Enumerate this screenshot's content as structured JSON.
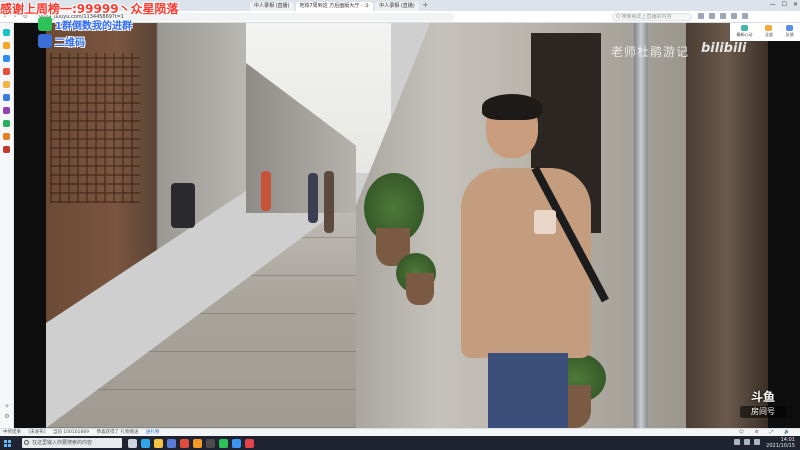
{
  "browser": {
    "tabs": [
      {
        "label": "中人录相 (直播)"
      },
      {
        "label": "地铁7周到这 方后面版大厅 - 斗"
      },
      {
        "label": "中人录相 (直播)"
      }
    ],
    "new_tab": "+",
    "window_controls": [
      "—",
      "☐",
      "✕"
    ],
    "url": "yuba_douyu.com/113445869?t=1",
    "search_placeholder": "Q 搜索朋友上直播的内容"
  },
  "right_panel": {
    "items": [
      {
        "label": "最新心动",
        "color": "#3fb6a8"
      },
      {
        "label": "全部",
        "color": "#f2a93b"
      },
      {
        "label": "反馈",
        "color": "#5a8dee"
      }
    ]
  },
  "overlay": {
    "banner": "感谢上周榜一:99999丶众星陨落",
    "badges": [
      {
        "text": "1群倒数我的进群",
        "icon": "wechat-icon",
        "color": "#2ec15a"
      },
      {
        "text": "二维码",
        "icon": "qq-icon",
        "color": "#3a6fd8"
      }
    ],
    "watermark_text": "老师杜鹃游记",
    "watermark_logo": "bilibili",
    "douyu_logo_top": "斗鱼",
    "douyu_logo_bottom": "房间号"
  },
  "info_strip": {
    "left": [
      "中奖结果",
      "[未发布]",
      "当前 100101869",
      "恭喜获得了 礼物赠送",
      "送礼物"
    ],
    "right": [
      "☺",
      "⚙",
      "⤢",
      "🔊"
    ]
  },
  "sidebar_icons": [
    {
      "name": "douyin-icon",
      "color": "#19c2c9"
    },
    {
      "name": "game-icon",
      "color": "#f5a623"
    },
    {
      "name": "chart-icon",
      "color": "#2e8df0"
    },
    {
      "name": "star-icon",
      "color": "#e74c3c"
    },
    {
      "name": "folder-icon",
      "color": "#f2b544"
    },
    {
      "name": "mail-icon",
      "color": "#3b7de0"
    },
    {
      "name": "apps-icon",
      "color": "#8e44ad"
    },
    {
      "name": "cloud-icon",
      "color": "#27ae60"
    },
    {
      "name": "tv-icon",
      "color": "#e67e22"
    },
    {
      "name": "note-icon",
      "color": "#c0392b"
    }
  ],
  "sidebar_bottom": [
    "+",
    "⚙"
  ],
  "taskbar": {
    "search_placeholder": "在这里输入你要搜索的内容",
    "apps": [
      {
        "name": "taskview-icon",
        "color": "#cfd6e2"
      },
      {
        "name": "edge-icon",
        "color": "#2ea6e8"
      },
      {
        "name": "explorer-icon",
        "color": "#f3c443"
      },
      {
        "name": "store-icon",
        "color": "#5a7bd8"
      },
      {
        "name": "chrome-icon",
        "color": "#e04b3a"
      },
      {
        "name": "douyu-app-icon",
        "color": "#f59a23"
      },
      {
        "name": "obs-icon",
        "color": "#4c4c4c"
      },
      {
        "name": "wechat-app-icon",
        "color": "#2ec15a"
      },
      {
        "name": "qq-app-icon",
        "color": "#3b95f0"
      },
      {
        "name": "music-icon",
        "color": "#e5424d"
      }
    ],
    "time": "14:01",
    "date": "2021/10/15"
  }
}
